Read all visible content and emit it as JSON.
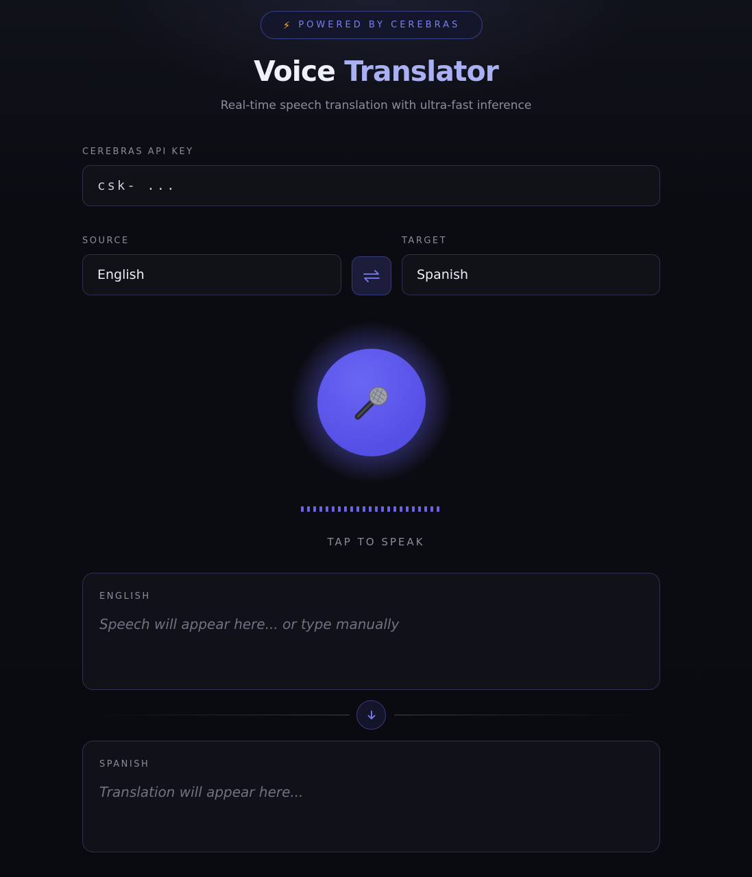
{
  "header": {
    "badge_icon": "lightning-icon",
    "badge_text": "POWERED BY CEREBRAS",
    "title_part1": "Voice",
    "title_part2": "Translator",
    "subtitle": "Real-time speech translation with ultra-fast inference"
  },
  "api_key": {
    "label": "CEREBRAS API KEY",
    "placeholder": "csk- ..."
  },
  "languages": {
    "source_label": "SOURCE",
    "source_value": "English",
    "target_label": "TARGET",
    "target_value": "Spanish",
    "swap_icon": "swap-arrows-icon"
  },
  "mic": {
    "icon": "microphone-icon",
    "hint": "TAP TO SPEAK"
  },
  "source_panel": {
    "label": "ENGLISH",
    "placeholder": "Speech will appear here... or type manually"
  },
  "divider": {
    "icon": "arrow-down-icon"
  },
  "target_panel": {
    "label": "SPANISH",
    "placeholder": "Translation will appear here..."
  },
  "colors": {
    "accent": "#5b55ec",
    "accent_text": "#7b7ff0",
    "bolt": "#f2b233"
  }
}
